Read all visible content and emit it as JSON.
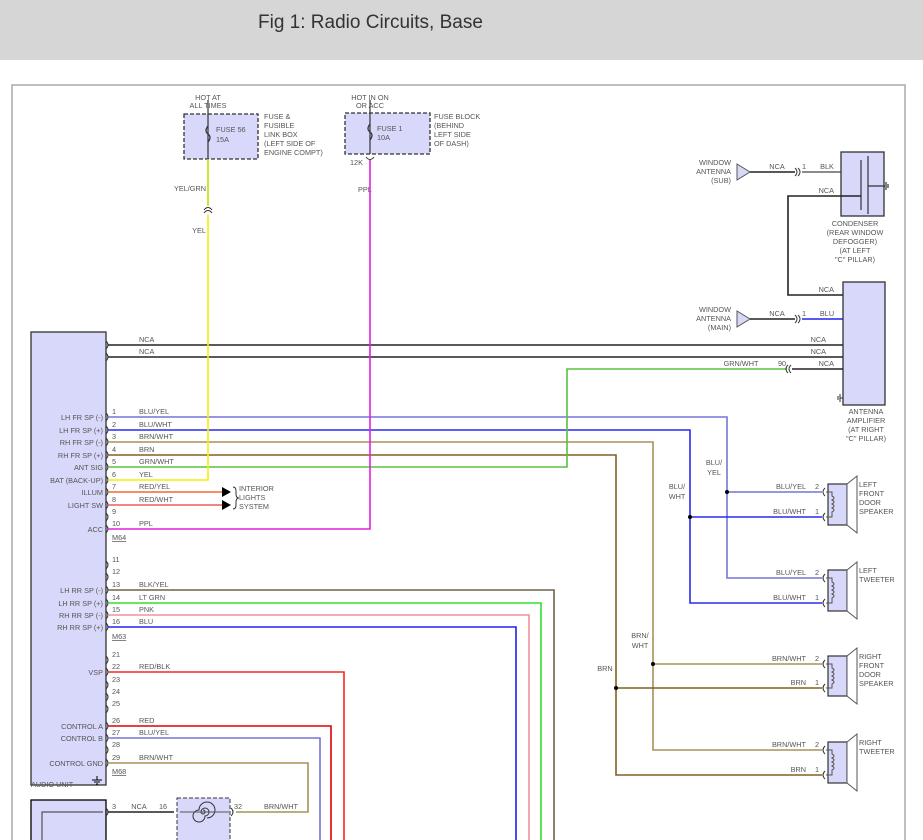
{
  "title": "Fig 1: Radio Circuits, Base",
  "fuses": [
    {
      "hot": [
        "HOT AT",
        "ALL TIMES"
      ],
      "name": "FUSE 56",
      "rating": "15A",
      "location": [
        "FUSE &",
        "FUSIBLE",
        "LINK BOX",
        "(LEFT SIDE OF",
        "ENGINE COMPT)"
      ],
      "wire_above": "YEL/GRN",
      "wire_below": "YEL"
    },
    {
      "hot": [
        "HOT IN ON",
        "OR ACC"
      ],
      "name": "FUSE 1",
      "rating": "10A",
      "location": [
        "FUSE BLOCK",
        "(BEHIND",
        "LEFT SIDE",
        "OF DASH)"
      ],
      "connector": "12K",
      "wire": "PPL"
    }
  ],
  "audio_unit": {
    "label": "AUDIO UNIT",
    "nca_wires": [
      "NCA",
      "NCA"
    ],
    "connectors": [
      "M64",
      "M63",
      "M68"
    ],
    "pins": [
      {
        "num": "1",
        "func": "LH FR SP (-)",
        "wire": "BLU/YEL"
      },
      {
        "num": "2",
        "func": "LH FR SP (+)",
        "wire": "BLU/WHT"
      },
      {
        "num": "3",
        "func": "RH FR SP (-)",
        "wire": "BRN/WHT"
      },
      {
        "num": "4",
        "func": "RH FR SP (+)",
        "wire": "BRN"
      },
      {
        "num": "5",
        "func": "ANT SIG",
        "wire": "GRN/WHT"
      },
      {
        "num": "6",
        "func": "BAT (BACK-UP)",
        "wire": "YEL"
      },
      {
        "num": "7",
        "func": "ILLUM",
        "wire": "RED/YEL"
      },
      {
        "num": "8",
        "func": "LIGHT SW",
        "wire": "RED/WHT"
      },
      {
        "num": "9",
        "func": "",
        "wire": ""
      },
      {
        "num": "10",
        "func": "ACC",
        "wire": "PPL"
      },
      {
        "num": "11",
        "func": "",
        "wire": ""
      },
      {
        "num": "12",
        "func": "",
        "wire": ""
      },
      {
        "num": "13",
        "func": "LH RR SP (-)",
        "wire": "BLK/YEL"
      },
      {
        "num": "14",
        "func": "LH RR SP (+)",
        "wire": "LT GRN"
      },
      {
        "num": "15",
        "func": "RH RR SP (-)",
        "wire": "PNK"
      },
      {
        "num": "16",
        "func": "RH RR SP (+)",
        "wire": "BLU"
      },
      {
        "num": "21",
        "func": "",
        "wire": ""
      },
      {
        "num": "22",
        "func": "VSP",
        "wire": "RED/BLK"
      },
      {
        "num": "23",
        "func": "",
        "wire": ""
      },
      {
        "num": "24",
        "func": "",
        "wire": ""
      },
      {
        "num": "25",
        "func": "",
        "wire": ""
      },
      {
        "num": "26",
        "func": "CONTROL A",
        "wire": "RED"
      },
      {
        "num": "27",
        "func": "CONTROL B",
        "wire": "BLU/YEL"
      },
      {
        "num": "28",
        "func": "",
        "wire": ""
      },
      {
        "num": "29",
        "func": "CONTROL GND",
        "wire": "BRN/WHT"
      }
    ]
  },
  "interior_lights": [
    "INTERIOR",
    "LIGHTS",
    "SYSTEM"
  ],
  "antennas": [
    {
      "label": [
        "WINDOW",
        "ANTENNA",
        "(SUB)"
      ],
      "wire": "NCA",
      "pin": "1",
      "wire2": "BLK"
    },
    {
      "label": [
        "WINDOW",
        "ANTENNA",
        "(MAIN)"
      ],
      "wire": "NCA",
      "pin": "1",
      "wire2": "BLU"
    }
  ],
  "condenser": {
    "label": [
      "CONDENSER",
      "(REAR WINDOW",
      "DEFOGGER)",
      "(AT LEFT",
      "\"C\" PILLAR)"
    ],
    "wire": "NCA"
  },
  "amplifier": {
    "label": [
      "ANTENNA",
      "AMPLIFIER",
      "(AT RIGHT",
      "\"C\" PILLAR)"
    ],
    "inputs": [
      "NCA",
      "NCA",
      "NCA",
      "NCA"
    ],
    "grn_connector": "90",
    "grn_wire": "GRN/WHT"
  },
  "junction_labels": {
    "blu_yel": [
      "BLU/",
      "YEL"
    ],
    "blu_wht": [
      "BLU/",
      "WHT"
    ],
    "brn_wht": [
      "BRN/",
      "WHT"
    ],
    "brn": "BRN"
  },
  "speakers": [
    {
      "name": [
        "LEFT",
        "FRONT",
        "DOOR",
        "SPEAKER"
      ],
      "pins": [
        {
          "num": "2",
          "wire": "BLU/YEL"
        },
        {
          "num": "1",
          "wire": "BLU/WHT"
        }
      ]
    },
    {
      "name": [
        "LEFT",
        "TWEETER"
      ],
      "pins": [
        {
          "num": "2",
          "wire": "BLU/YEL"
        },
        {
          "num": "1",
          "wire": "BLU/WHT"
        }
      ]
    },
    {
      "name": [
        "RIGHT",
        "FRONT",
        "DOOR",
        "SPEAKER"
      ],
      "pins": [
        {
          "num": "2",
          "wire": "BRN/WHT"
        },
        {
          "num": "1",
          "wire": "BRN"
        }
      ]
    },
    {
      "name": [
        "RIGHT",
        "TWEETER"
      ],
      "pins": [
        {
          "num": "2",
          "wire": "BRN/WHT"
        },
        {
          "num": "1",
          "wire": "BRN"
        }
      ]
    }
  ],
  "bottom": {
    "pin": "3",
    "wire": "NCA",
    "conn_in": "16",
    "conn_out": "32",
    "wire_out": "BRN/WHT"
  },
  "wire_colors": {
    "BLU/YEL": "#7474d8",
    "BLU/WHT": "#2a2aee",
    "BRN/WHT": "#a89058",
    "BRN": "#806020",
    "GRN/WHT": "#58c040",
    "YEL": "#f4f000",
    "YEL/GRN": "#c8dc00",
    "RED/YEL": "#f06a30",
    "RED/WHT": "#f05a5a",
    "PPL": "#e020e0",
    "BLK/YEL": "#6e6248",
    "LT GRN": "#30e030",
    "PNK": "#f090a0",
    "BLU": "#2020f0",
    "RED/BLK": "#f02828",
    "RED": "#e00000",
    "NCA": "#222222",
    "component_fill": "#d8d8fa"
  }
}
